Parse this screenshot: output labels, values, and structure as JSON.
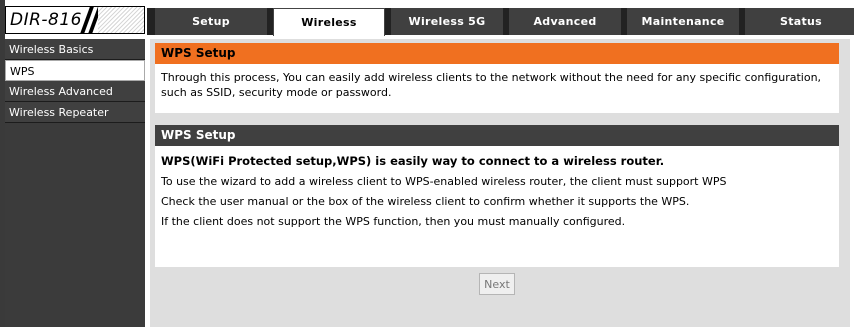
{
  "logo": {
    "text": "DIR-816"
  },
  "tabs": [
    {
      "label": "Setup"
    },
    {
      "label": "Wireless"
    },
    {
      "label": "Wireless 5G"
    },
    {
      "label": "Advanced"
    },
    {
      "label": "Maintenance"
    },
    {
      "label": "Status"
    }
  ],
  "active_tab": "Wireless",
  "sidebar": {
    "items": [
      {
        "label": "Wireless Basics"
      },
      {
        "label": "WPS"
      },
      {
        "label": "Wireless Advanced"
      },
      {
        "label": "Wireless Repeater"
      }
    ],
    "active": "WPS"
  },
  "panel1": {
    "title": "WPS Setup",
    "text": "Through this process, You can easily add wireless clients to the network without the need for any specific configuration, such as SSID, security mode or password."
  },
  "panel2": {
    "title": "WPS Setup",
    "heading": "WPS(WiFi Protected setup,WPS) is easily way to connect to a wireless router.",
    "lines": [
      "To use the wizard to add a wireless client to WPS-enabled wireless router, the client must support WPS",
      "Check the user manual or the box of the wireless client to confirm whether it supports the WPS.",
      "If the client does not support the WPS function, then you must manually configured."
    ]
  },
  "buttons": {
    "next": "Next"
  },
  "colors": {
    "orange_header": "#f07020",
    "dark_header": "#404040",
    "content_bg": "#dedede"
  }
}
